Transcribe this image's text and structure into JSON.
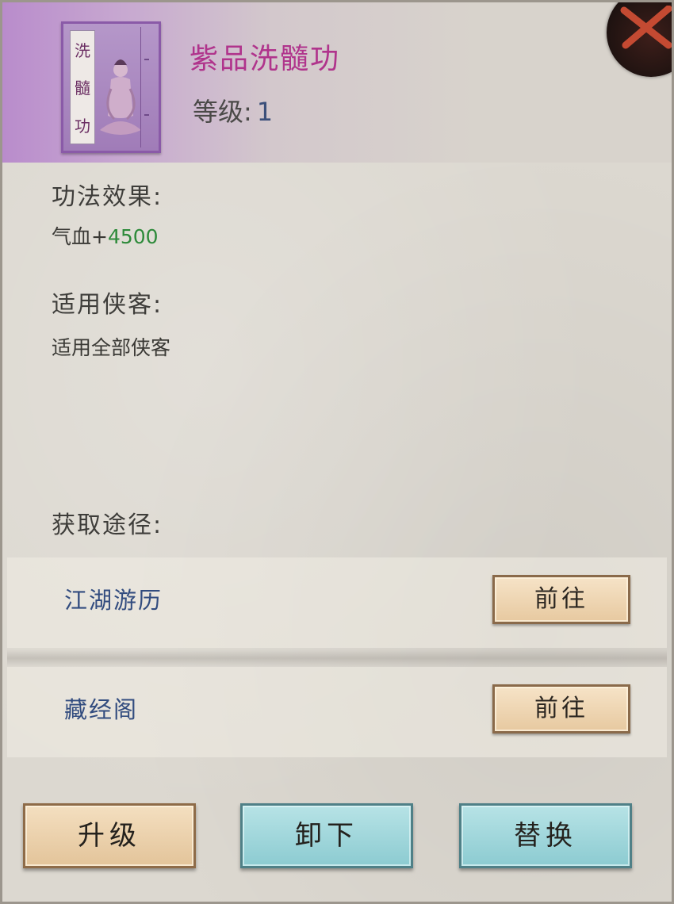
{
  "skill": {
    "book_title_chars": [
      "洗",
      "髓",
      "功"
    ],
    "name": "紫品洗髓功",
    "level_label": "等级:",
    "level_value": "1",
    "quality_color": "#b0348c"
  },
  "effect": {
    "label": "功法效果:",
    "stat_name": "气血+",
    "stat_value": "4500",
    "stat_value_color": "#2d8a3a"
  },
  "applicable": {
    "label": "适用侠客:",
    "text": "适用全部侠客"
  },
  "acquire": {
    "label": "获取途径:",
    "routes": [
      {
        "name": "江湖游历",
        "button": "前往"
      },
      {
        "name": "藏经阁",
        "button": "前往"
      }
    ]
  },
  "actions": {
    "upgrade": "升级",
    "unequip": "卸下",
    "replace": "替换"
  },
  "icons": {
    "close": "close-icon",
    "book": "skill-book-icon"
  }
}
